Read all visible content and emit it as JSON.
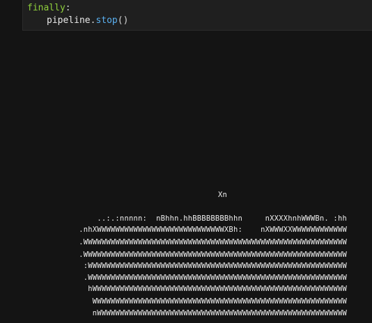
{
  "code": {
    "keyword": "finally",
    "colon": ":",
    "object": "pipeline",
    "dot": ".",
    "method": "stop",
    "parens": "()"
  },
  "output": {
    "title_line": "Xn",
    "art_lines": [
      "..:.:nnnnn:  nBhhn.hhBBBBBBBBhhn     nXXXXhnhWWWBn. :hh",
      ".nhXWWWWWWWWWWWWWWWWWWWWWWWWWWWWXBh:    nXWWWXXWWWWWWWWWWWW",
      ".WWWWWWWWWWWWWWWWWWWWWWWWWWWWWWWWWWWWWWWWWWWWWWWWWWWWWWWWWW",
      ".WWWWWWWWWWWWWWWWWWWWWWWWWWWWWWWWWWWWWWWWWWWWWWWWWWWWWWWWWW",
      ":WWWWWWWWWWWWWWWWWWWWWWWWWWWWWWWWWWWWWWWWWWWWWWWWWWWWWWWWW",
      ".WWWWWWWWWWWWWWWWWWWWWWWWWWWWWWWWWWWWWWWWWWWWWWWWWWWWWWWWW",
      "hWWWWWWWWWWWWWWWWWWWWWWWWWWWWWWWWWWWWWWWWWWWWWWWWWWWWWWWW",
      "WWWWWWWWWWWWWWWWWWWWWWWWWWWWWWWWWWWWWWWWWWWWWWWWWWWWWWWW",
      "nWWWWWWWWWWWWWWWWWWWWWWWWWWWWWWWWWWWWWWWWWWWWWWWWWWWWWWW"
    ]
  }
}
